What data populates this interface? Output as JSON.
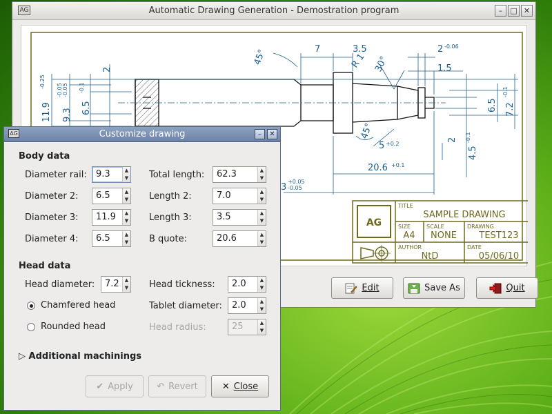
{
  "main_window": {
    "title": "Automatic Drawing Generation - Demostration program",
    "logo_text": "AG",
    "controls": [
      "–",
      "□",
      "✕"
    ]
  },
  "drawing": {
    "dims": {
      "d7": "7",
      "d35": "3.5",
      "d2top": "2",
      "d2top_tol": "-0.06",
      "d15": "1.5",
      "r1": "R 1",
      "a45_top": "45°",
      "a30": "30°",
      "a45_bot": "45°",
      "d2_left": "2",
      "d2_mid": "2",
      "d119": "11.9",
      "d119_tol": "-0.25",
      "d93": "9.3",
      "d93_tol_up": "-0.05",
      "d93_tol_low": "-0.05",
      "d65_left": "6.5",
      "d65_left_tol": "-0.1",
      "d65_right": "6.5",
      "d72": "7.2",
      "d72_tol": "-0.1",
      "d45": "4.5",
      "d45_tol": "-0.1",
      "d5": "5",
      "d5_tol": "+0.2",
      "d206": "20.6",
      "d206_tol": "+0.1",
      "d3": "3",
      "d3_tol_up": "+0.05",
      "d3_tol_low": "-0.05"
    },
    "titleblock": {
      "title_label": "TITLE",
      "title": "SAMPLE DRAWING",
      "size_label": "SIZE",
      "size": "A4",
      "scale_label": "SCALE",
      "scale": "NONE",
      "drawing_label": "DRAWING",
      "drawing": "TEST123",
      "author_label": "AUTHOR",
      "author": "NtD",
      "date_label": "DATE",
      "date": "05/06/10",
      "logo_text": "AG"
    }
  },
  "buttons": {
    "edit": "Edit",
    "save_as": "Save As",
    "quit": "Quit"
  },
  "dialog": {
    "title": "Customize drawing",
    "logo_text": "AG",
    "body_section": "Body data",
    "head_section": "Head data",
    "fields": {
      "diameter_rail": {
        "label": "Diameter rail:",
        "value": "9.3"
      },
      "diameter_2": {
        "label": "Diameter 2:",
        "value": "6.5"
      },
      "diameter_3": {
        "label": "Diameter 3:",
        "value": "11.9"
      },
      "diameter_4": {
        "label": "Diameter 4:",
        "value": "6.5"
      },
      "total_length": {
        "label": "Total length:",
        "value": "62.3"
      },
      "length_2": {
        "label": "Length 2:",
        "value": "7.0"
      },
      "length_3": {
        "label": "Length 3:",
        "value": "3.5"
      },
      "b_quote": {
        "label": "B quote:",
        "value": "20.6"
      },
      "head_diameter": {
        "label": "Head diameter:",
        "value": "7.2"
      },
      "head_thickness": {
        "label": "Head tickness:",
        "value": "2.0"
      },
      "tablet_diameter": {
        "label": "Tablet diameter:",
        "value": "2.0"
      },
      "head_radius": {
        "label": "Head radius:",
        "value": "25"
      }
    },
    "radio_chamfered": "Chamfered head",
    "radio_rounded": "Rounded head",
    "selected_head": "chamfered",
    "expander": "Additional machinings",
    "apply": "Apply",
    "revert": "Revert",
    "close": "Close"
  },
  "colors": {
    "dimension_blue": "#1a5f8e",
    "titleblock_olive": "#6f6a1e"
  }
}
